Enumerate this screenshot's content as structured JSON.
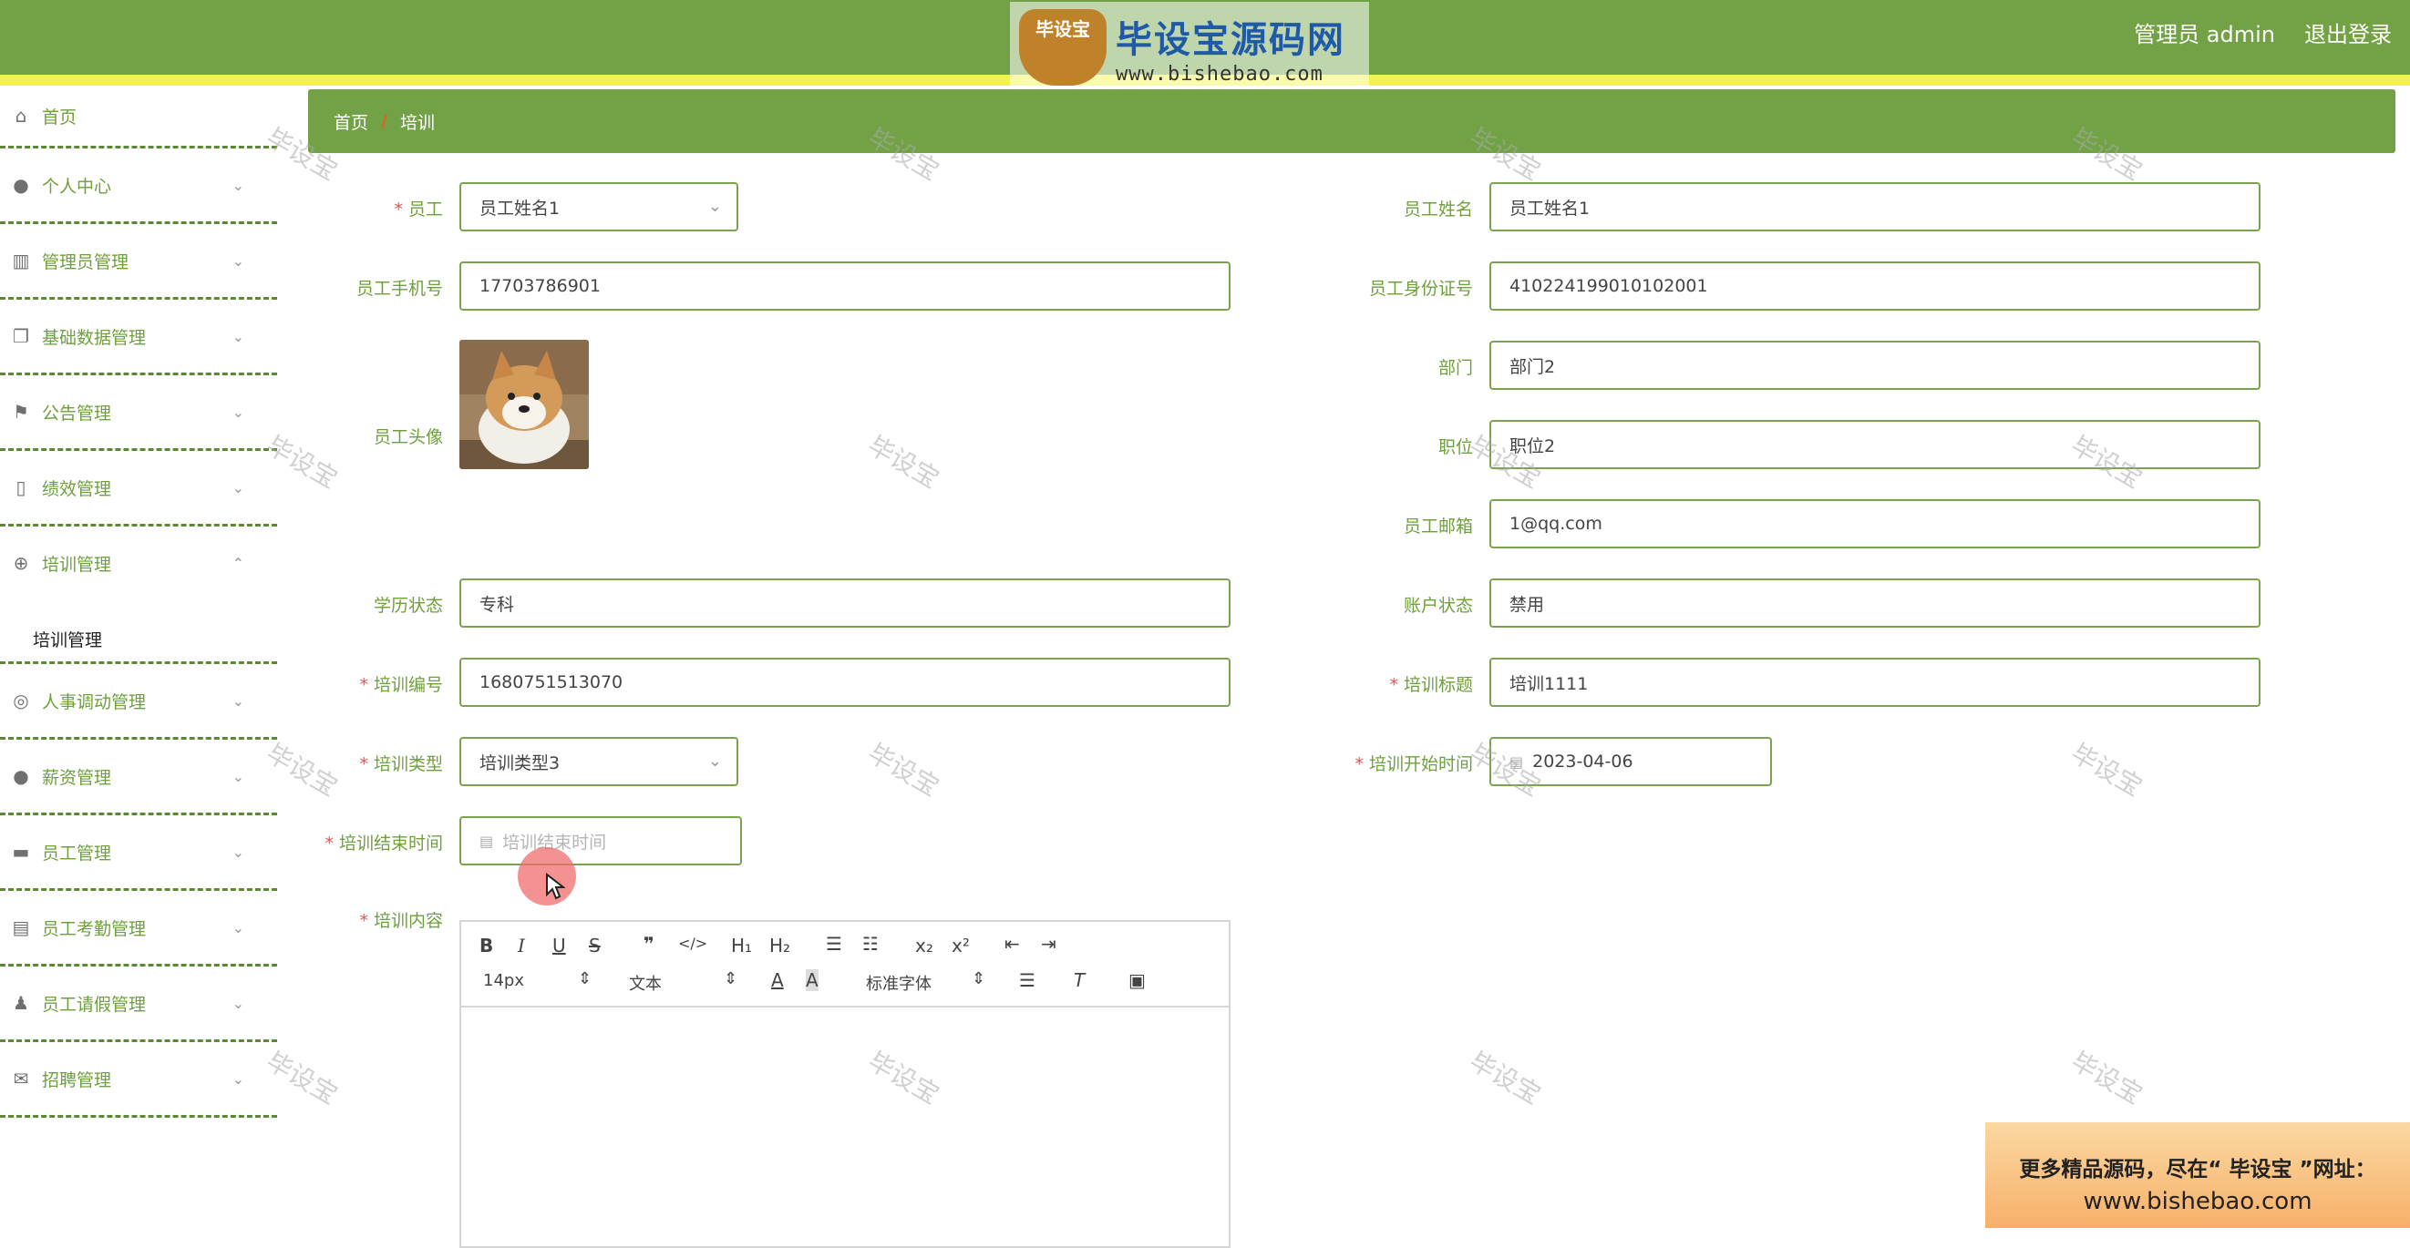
{
  "header": {
    "logo_badge": "毕设宝",
    "logo_title": "毕设宝源码网",
    "logo_url": "www.bishebao.com",
    "user_label": "管理员 admin",
    "logout_label": "退出登录"
  },
  "sidebar": {
    "items": [
      {
        "label": "首页",
        "icon": "home-icon"
      },
      {
        "label": "个人中心",
        "icon": "user-icon"
      },
      {
        "label": "管理员管理",
        "icon": "books-icon"
      },
      {
        "label": "基础数据管理",
        "icon": "copy-icon"
      },
      {
        "label": "公告管理",
        "icon": "flag-icon"
      },
      {
        "label": "绩效管理",
        "icon": "phone-icon"
      },
      {
        "label": "培训管理",
        "icon": "target-icon"
      },
      {
        "label": "人事调动管理",
        "icon": "swap-icon"
      },
      {
        "label": "薪资管理",
        "icon": "bulb-icon"
      },
      {
        "label": "员工管理",
        "icon": "ticket-icon"
      },
      {
        "label": "员工考勤管理",
        "icon": "clipboard-icon"
      },
      {
        "label": "员工请假管理",
        "icon": "person-icon"
      },
      {
        "label": "招聘管理",
        "icon": "mail-icon"
      }
    ],
    "sub_active": "培训管理"
  },
  "breadcrumb": {
    "home": "首页",
    "sep": "/",
    "current": "培训"
  },
  "form": {
    "employee": {
      "label": "员工",
      "value": "员工姓名1"
    },
    "employee_name": {
      "label": "员工姓名",
      "value": "员工姓名1"
    },
    "phone": {
      "label": "员工手机号",
      "value": "17703786901"
    },
    "id_card": {
      "label": "员工身份证号",
      "value": "410224199010102001"
    },
    "avatar": {
      "label": "员工头像"
    },
    "department": {
      "label": "部门",
      "value": "部门2"
    },
    "position": {
      "label": "职位",
      "value": "职位2"
    },
    "email": {
      "label": "员工邮箱",
      "value": "1@qq.com"
    },
    "education": {
      "label": "学历状态",
      "value": "专科"
    },
    "account": {
      "label": "账户状态",
      "value": "禁用"
    },
    "train_no": {
      "label": "培训编号",
      "value": "1680751513070"
    },
    "train_title": {
      "label": "培训标题",
      "value": "培训1111"
    },
    "train_type": {
      "label": "培训类型",
      "value": "培训类型3"
    },
    "train_start": {
      "label": "培训开始时间",
      "value": "2023-04-06"
    },
    "train_end": {
      "label": "培训结束时间",
      "placeholder": "培训结束时间"
    },
    "train_content": {
      "label": "培训内容"
    }
  },
  "editor": {
    "font_size": "14px",
    "block_type": "文本",
    "font_family": "标准字体"
  },
  "watermark": "毕设宝",
  "promo": {
    "line1": "更多精品源码，尽在“ 毕设宝 ”网址：",
    "line2": "www.bishebao.com"
  }
}
